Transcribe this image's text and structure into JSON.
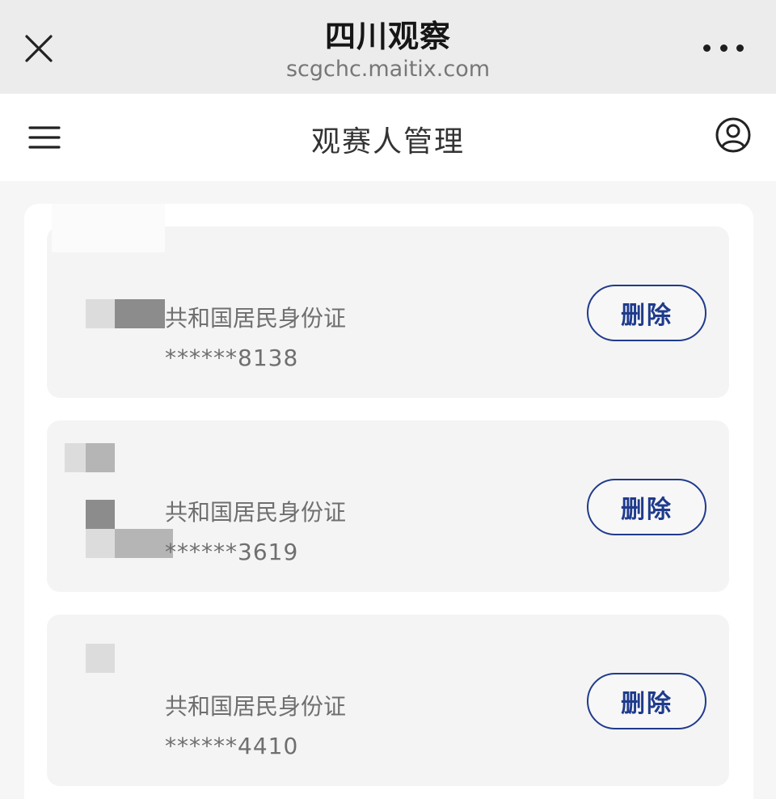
{
  "browser": {
    "title": "四川观察",
    "url": "scgchc.maitix.com",
    "close_icon": "close-icon",
    "more_icon": "more-icon"
  },
  "header": {
    "title": "观赛人管理",
    "menu_icon": "hamburger-menu-icon",
    "user_icon": "user-account-icon"
  },
  "viewers": [
    {
      "id_type": "共和国居民身份证",
      "id_number": "******8138",
      "delete_label": "删除"
    },
    {
      "id_type": "共和国居民身份证",
      "id_number": "******3619",
      "delete_label": "删除"
    },
    {
      "id_type": "共和国居民身份证",
      "id_number": "******4410",
      "delete_label": "删除"
    }
  ],
  "colors": {
    "accent": "#1f3b8c",
    "topbar_bg": "#ececec",
    "card_bg": "#f4f4f4",
    "text_secondary": "#6f6f6f"
  }
}
